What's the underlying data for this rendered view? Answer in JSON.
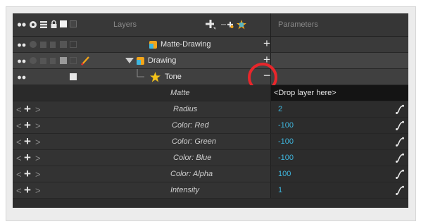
{
  "header": {
    "layers_label": "Layers",
    "parameters_label": "Parameters",
    "icons": [
      "animate-toggle-icon",
      "visibility-icon",
      "stack-icon",
      "lock-icon",
      "color-swatch-icon",
      "thumbnail-icon",
      "add-layer-icon",
      "add-peg-icon",
      "add-effect-icon"
    ]
  },
  "layers": [
    {
      "name": "Matte-Drawing",
      "icon": "drawing-layer-icon",
      "action": "+",
      "selected": false
    },
    {
      "name": "Drawing",
      "icon": "drawing-layer-icon",
      "action": "+",
      "selected": true,
      "expanded": true
    },
    {
      "name": "Tone",
      "icon": "tone-effect-icon",
      "action": "−",
      "selected": false
    }
  ],
  "parameters": [
    {
      "label": "Matte",
      "value": "<Drop layer here>",
      "has_curve": false,
      "has_nav": false
    },
    {
      "label": "Radius",
      "value": "2",
      "has_curve": true,
      "has_nav": true
    },
    {
      "label": "Color: Red",
      "value": "-100",
      "has_curve": true,
      "has_nav": true
    },
    {
      "label": "Color: Green",
      "value": "-100",
      "has_curve": true,
      "has_nav": true
    },
    {
      "label": "Color: Blue",
      "value": "-100",
      "has_curve": true,
      "has_nav": true
    },
    {
      "label": "Color: Alpha",
      "value": "100",
      "has_curve": true,
      "has_nav": true
    },
    {
      "label": "Intensity",
      "value": "1",
      "has_curve": true,
      "has_nav": true
    }
  ],
  "nav": {
    "prev": "<",
    "add": "+",
    "next": ">"
  },
  "colors": {
    "highlight_circle": "#e8262b",
    "value_text": "#3fb7df",
    "panel_bg": "#2d2d2d"
  }
}
